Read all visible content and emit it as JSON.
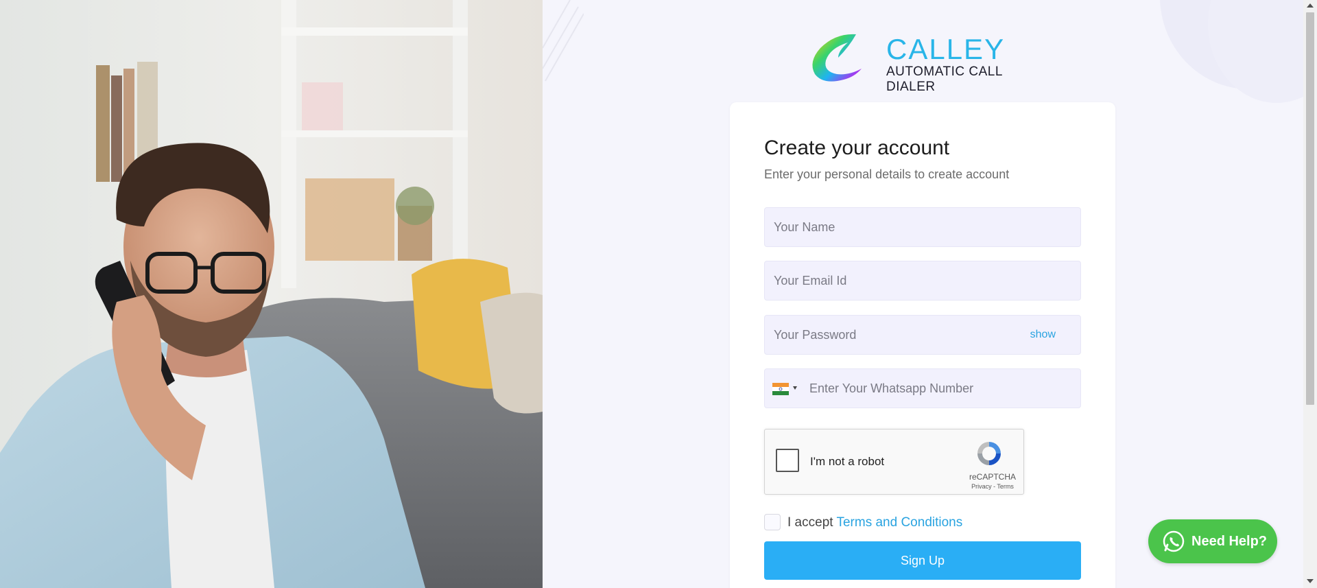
{
  "brand": {
    "name": "CALLEY",
    "tagline": "AUTOMATIC CALL DIALER"
  },
  "form": {
    "title": "Create your account",
    "subtitle": "Enter your personal details to create account",
    "name_placeholder": "Your Name",
    "email_placeholder": "Your Email Id",
    "password_placeholder": "Your Password",
    "password_toggle": "show",
    "phone_placeholder": "Enter Your Whatsapp Number",
    "phone_country_icon": "india-flag-icon",
    "recaptcha": {
      "label": "I'm not a robot",
      "brand": "reCAPTCHA",
      "links": "Privacy - Terms"
    },
    "accept_prefix": "I accept ",
    "accept_link": "Terms and Conditions",
    "submit_label": "Sign Up"
  },
  "help": {
    "label": "Need Help?",
    "icon": "whatsapp-icon"
  },
  "colors": {
    "accent": "#29b5e8",
    "button": "#2aaef5",
    "help": "#4bc44b",
    "field_bg": "#f2f1fd",
    "page_bg": "#f5f5fc"
  }
}
